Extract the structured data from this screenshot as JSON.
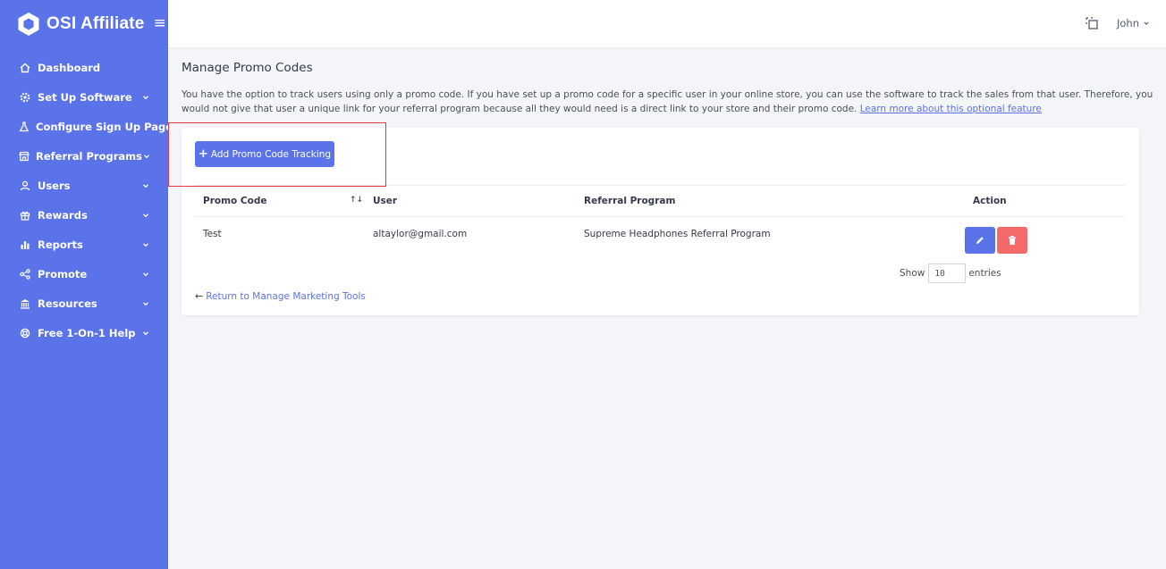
{
  "brand": {
    "name": "OSI Affiliate"
  },
  "sidebar": {
    "items": [
      {
        "label": "Dashboard",
        "icon": "home-icon",
        "has_children": false
      },
      {
        "label": "Set Up Software",
        "icon": "cog-icon",
        "has_children": true
      },
      {
        "label": "Configure Sign Up Page",
        "icon": "flask-icon",
        "has_children": false
      },
      {
        "label": "Referral Programs",
        "icon": "store-icon",
        "has_children": true
      },
      {
        "label": "Users",
        "icon": "user-icon",
        "has_children": true
      },
      {
        "label": "Rewards",
        "icon": "gift-icon",
        "has_children": true
      },
      {
        "label": "Reports",
        "icon": "bar-chart-icon",
        "has_children": true
      },
      {
        "label": "Promote",
        "icon": "share-icon",
        "has_children": true
      },
      {
        "label": "Resources",
        "icon": "bank-icon",
        "has_children": true
      },
      {
        "label": "Free 1-On-1 Help",
        "icon": "lifebuoy-icon",
        "has_children": true
      }
    ]
  },
  "topbar": {
    "user_name": "John"
  },
  "page": {
    "title": "Manage Promo Codes",
    "intro": "You have the option to track users using only a promo code. If you have set up a promo code for a specific user in your online store, you can use the software to track the sales from that user. Therefore, you would not give that user a unique link for your referral program because all they would need is a direct link to your store and their promo code. ",
    "intro_link": "Learn more about this optional feature"
  },
  "card": {
    "add_button": "Add Promo Code Tracking",
    "columns": {
      "code": "Promo Code",
      "user": "User",
      "program": "Referral Program",
      "action": "Action"
    },
    "rows": [
      {
        "code": "Test",
        "user": "altaylor@gmail.com",
        "program": "Supreme Headphones Referral Program"
      }
    ],
    "entries": {
      "show": "Show",
      "value": "10",
      "suffix": "entries"
    },
    "return_link": "Return to Manage Marketing Tools"
  },
  "colors": {
    "sidebar": "#5b73e8",
    "primary": "#5b73e8",
    "danger": "#f46a6a",
    "highlight": "#e0383e"
  }
}
